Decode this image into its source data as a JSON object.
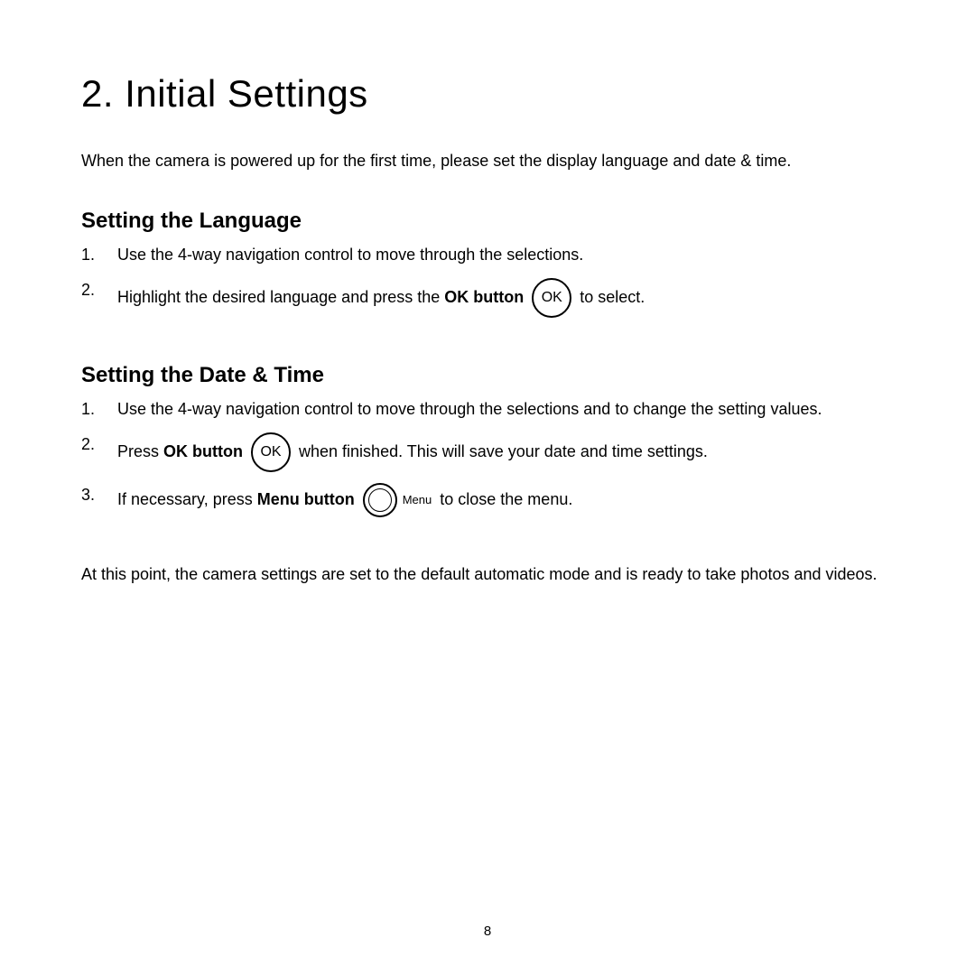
{
  "chapter": {
    "title": "2. Initial Settings",
    "intro": "When the camera is powered up for the first time, please set the display language and date & time."
  },
  "sections": {
    "language": {
      "heading": "Setting the Language",
      "items": {
        "i1": "Use the 4-way navigation control to move through the selections.",
        "i2_pre": "Highlight the desired language and press the ",
        "i2_btn": "OK button",
        "i2_post": " to select."
      }
    },
    "datetime": {
      "heading": "Setting the Date & Time",
      "items": {
        "i1": "Use the 4-way navigation control to move through the selections and to change the setting values.",
        "i2_pre": "Press ",
        "i2_btn": "OK button",
        "i2_post": " when finished. This will save your date and time settings.",
        "i3_pre": "If necessary, press ",
        "i3_btn": "Menu button",
        "i3_post": " to close the menu."
      }
    }
  },
  "icons": {
    "ok_label": "OK",
    "menu_label": "Menu"
  },
  "closing": "At this point, the camera settings are set to the default automatic mode and is ready to take photos and videos.",
  "page_number": "8"
}
